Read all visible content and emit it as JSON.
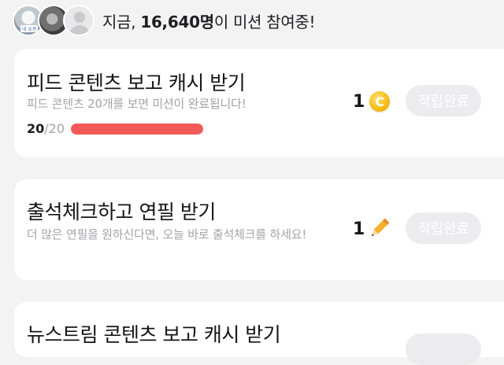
{
  "header": {
    "prefix": "지금, ",
    "count": "16,640명",
    "suffix": "이 미션 참여중!",
    "avatar_tag": "내 쇼핑"
  },
  "missions": [
    {
      "title": "피드 콘텐츠 보고 캐시 받기",
      "description": "피드 콘텐츠 20개를 보면 미션이 완료됩니다!",
      "progress_current": "20",
      "progress_total": "/20",
      "progress_fraction": 1.0,
      "reward_amount": "1",
      "reward_icon": "coin-icon",
      "coin_glyph": "C",
      "button_label": "적립완료"
    },
    {
      "title": "출석체크하고 연필 받기",
      "description": "더 많은 연필을 원하신다면, 오늘 바로 출석체크를 하세요!",
      "reward_amount": "1",
      "reward_icon": "pencil-icon",
      "button_label": "적립완료"
    },
    {
      "title": "뉴스트림 콘텐츠 보고 캐시 받기"
    }
  ],
  "colors": {
    "background": "#f3f3f4",
    "progress": "#f25a57",
    "button_disabled": "#ececee",
    "coin": "#f5b400",
    "pencil": "#f4b02e"
  }
}
